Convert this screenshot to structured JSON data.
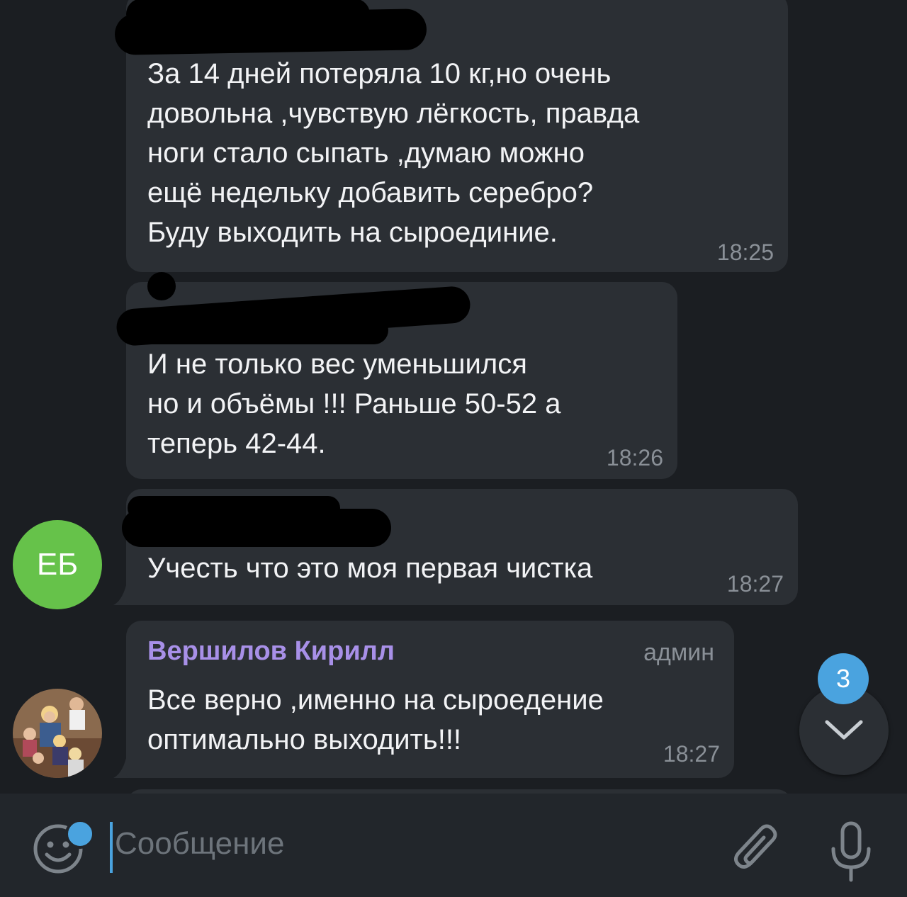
{
  "messages": [
    {
      "text": "За 14 дней потеряла 10 кг,но очень\nдовольна ,чувствую лёгкость, правда\nноги стало сыпать ,думаю можно\nещё недельку добавить серебро?\nБуду выходить на сыроединие.",
      "time": "18:25"
    },
    {
      "text": "И не только вес уменьшился\nно и объёмы !!! Раньше 50-52 а\nтеперь 42-44.",
      "time": "18:26"
    },
    {
      "text": "Учесть что это моя первая чистка",
      "time": "18:27",
      "avatar_initials": "ЕБ"
    },
    {
      "sender": "Вершилов Кирилл",
      "role": "админ",
      "text": "Все верно ,именно на сыроедение\nоптимально выходить!!!",
      "time": "18:27"
    }
  ],
  "scroll_down": {
    "unread_count": "3",
    "icon": "chevron-down-icon"
  },
  "composer": {
    "placeholder": "Сообщение",
    "emoji_icon": "smile-icon",
    "attach_icon": "paperclip-icon",
    "mic_icon": "microphone-icon"
  },
  "colors": {
    "background": "#1b1e22",
    "bubble": "#2b2f34",
    "accent": "#4aa3df",
    "sender_name": "#a890e8",
    "avatar_green": "#66c24a"
  }
}
